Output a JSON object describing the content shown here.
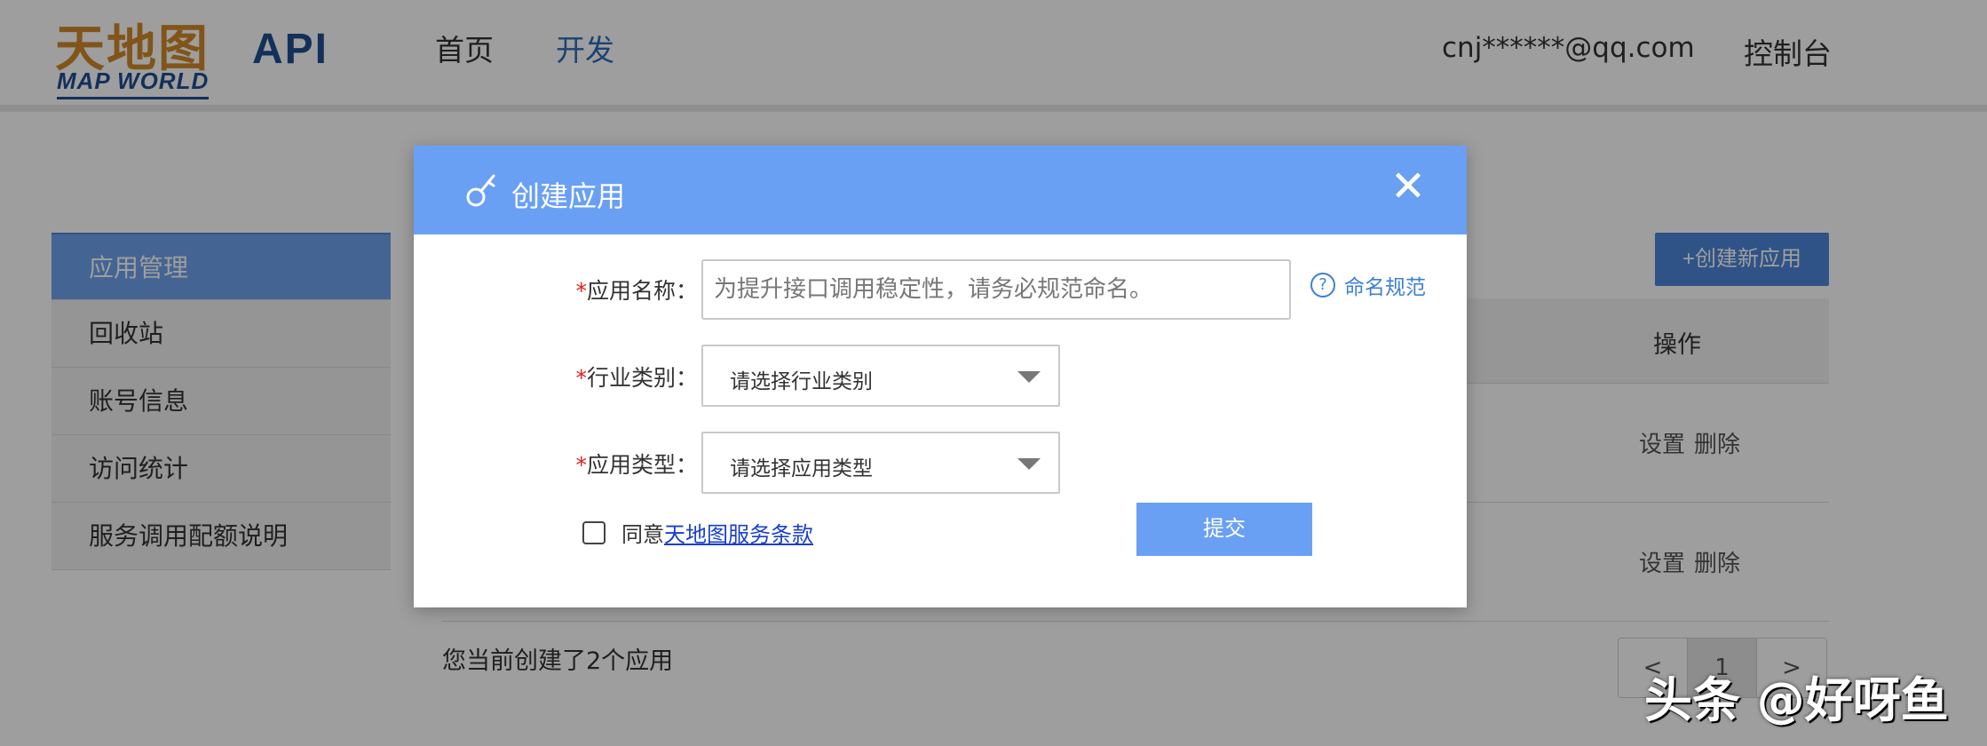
{
  "header": {
    "logo_cn": "天地图",
    "logo_en": "MAP WORLD",
    "brand": "API",
    "nav": {
      "home": "首页",
      "dev": "开发"
    },
    "user_email": "cnj******@qq.com",
    "console": "控制台"
  },
  "sidebar": {
    "items": [
      {
        "label": "应用管理"
      },
      {
        "label": "回收站"
      },
      {
        "label": "账号信息"
      },
      {
        "label": "访问统计"
      },
      {
        "label": "服务调用配额说明"
      }
    ]
  },
  "main": {
    "create_button": "+创建新应用",
    "table": {
      "ops_header": "操作",
      "rows": [
        {
          "settings": "设置",
          "delete": "删除"
        },
        {
          "settings": "设置",
          "delete": "删除"
        }
      ]
    },
    "summary": "您当前创建了2个应用",
    "pager": {
      "prev": "<",
      "page": "1",
      "next": ">"
    }
  },
  "modal": {
    "title": "创建应用",
    "close": "✕",
    "required_mark": "*",
    "name_label": "应用名称：",
    "name_placeholder": "为提升接口调用稳定性，请务必规范命名。",
    "naming_rule": "命名规范",
    "help_glyph": "?",
    "industry_label": "行业类别：",
    "industry_value": "请选择行业类别",
    "type_label": "应用类型：",
    "type_value": "请选择应用类型",
    "agree_prefix": "同意",
    "terms_link": "天地图服务条款",
    "submit": "提交"
  },
  "watermark": "头条 @好呀鱼",
  "colors": {
    "modal_header": "#6aa0f4",
    "primary_button": "#4d86d8",
    "required": "#e02020",
    "link": "#1a3fc9"
  }
}
